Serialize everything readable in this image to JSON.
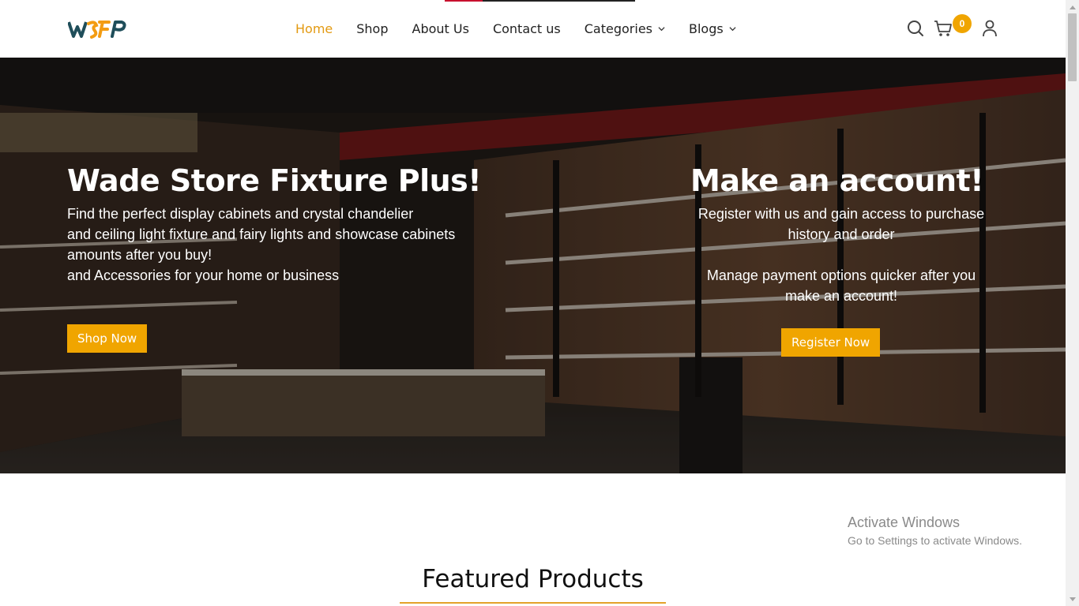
{
  "header": {
    "logo_text": "WSFP",
    "nav": [
      {
        "label": "Home",
        "active": true,
        "dropdown": false
      },
      {
        "label": "Shop",
        "active": false,
        "dropdown": false
      },
      {
        "label": "About Us",
        "active": false,
        "dropdown": false
      },
      {
        "label": "Contact us",
        "active": false,
        "dropdown": false
      },
      {
        "label": "Categories",
        "active": false,
        "dropdown": true
      },
      {
        "label": "Blogs",
        "active": false,
        "dropdown": true
      }
    ],
    "cart_count": "0",
    "icons": [
      "search-icon",
      "cart-icon",
      "user-icon"
    ]
  },
  "hero": {
    "left": {
      "title": "Wade Store Fixture Plus!",
      "lines": [
        "Find the perfect display cabinets and crystal chandelier",
        "and ceiling light fixture and fairy lights and showcase cabinets",
        "amounts after you buy!",
        "and Accessories for your home or business"
      ],
      "button": "Shop Now"
    },
    "right": {
      "title": "Make an account!",
      "lines": [
        "Register with us and gain access to purchase",
        "history and order",
        "",
        "Manage payment options quicker after you",
        "make an account!"
      ],
      "button": "Register Now"
    }
  },
  "watermark": {
    "title": "Activate Windows",
    "subtitle": "Go to Settings to activate Windows."
  },
  "featured": {
    "title": "Featured Products"
  },
  "colors": {
    "accent": "#f0a500",
    "nav_active": "#e39a12",
    "logo_dark": "#1f4e5a",
    "logo_orange": "#f39c12"
  }
}
